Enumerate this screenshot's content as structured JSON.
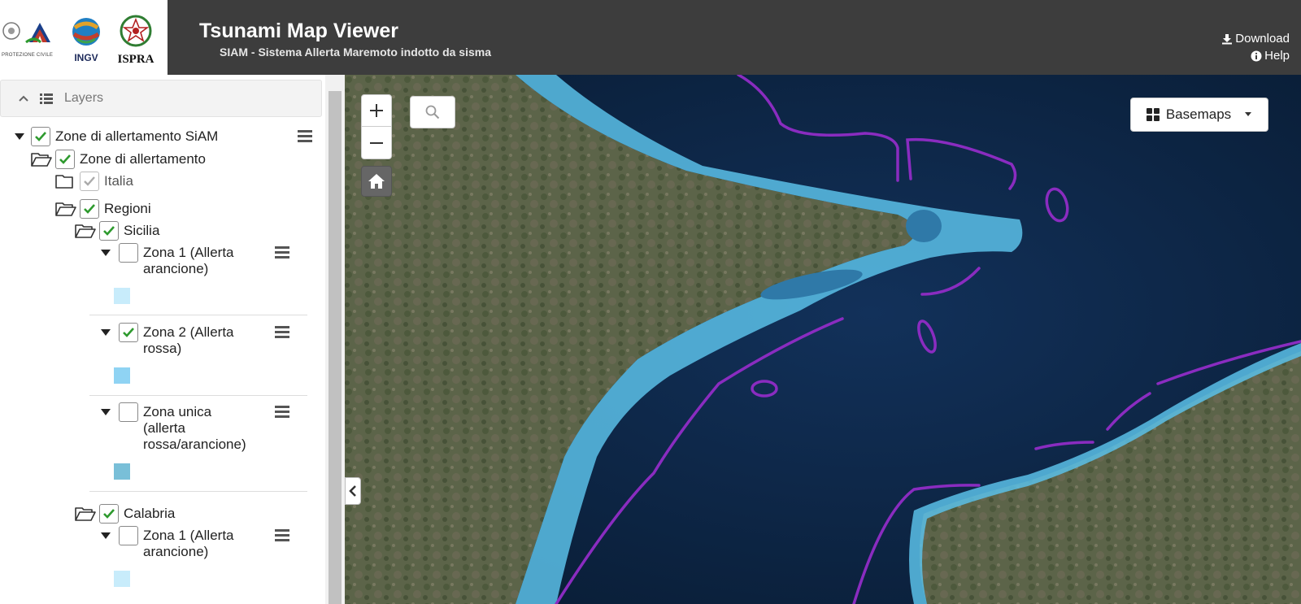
{
  "header": {
    "logos": [
      "PROTEZIONE CIVILE",
      "INGV",
      "ISPRA"
    ],
    "title": "Tsunami Map Viewer",
    "subtitle": "SIAM - Sistema Allerta Maremoto indotto da sisma",
    "download_label": "Download",
    "help_label": "Help"
  },
  "sidebar": {
    "panel_title": "Layers",
    "tree": {
      "root": "Zone di allertamento SiAM",
      "zone_group": "Zone di allertamento",
      "italia": "Italia",
      "regioni": "Regioni",
      "sicilia": "Sicilia",
      "sicilia_zona1": [
        "Zona 1 (Allerta",
        "arancione)"
      ],
      "sicilia_zona2": [
        "Zona 2 (Allerta",
        "rossa)"
      ],
      "sicilia_zona_unica": [
        "Zona unica",
        "(allerta",
        "rossa/arancione)"
      ],
      "calabria": "Calabria",
      "calabria_zona1": [
        "Zona 1 (Allerta",
        "arancione)"
      ]
    },
    "swatch_colors": {
      "zona1": "#c8ecfb",
      "zona2": "#8fd3f3",
      "zona_unica": "#79bfd8"
    }
  },
  "map": {
    "basemaps_label": "Basemaps",
    "colors": {
      "sea": "#0b2440",
      "land": "#5b6349",
      "alert_zone": "#5bbfe8",
      "fault_lines": "#8a2cc0"
    }
  },
  "colors": {
    "header_bg": "#3d3d3d",
    "checkbox_green": "#2e9a2e"
  }
}
